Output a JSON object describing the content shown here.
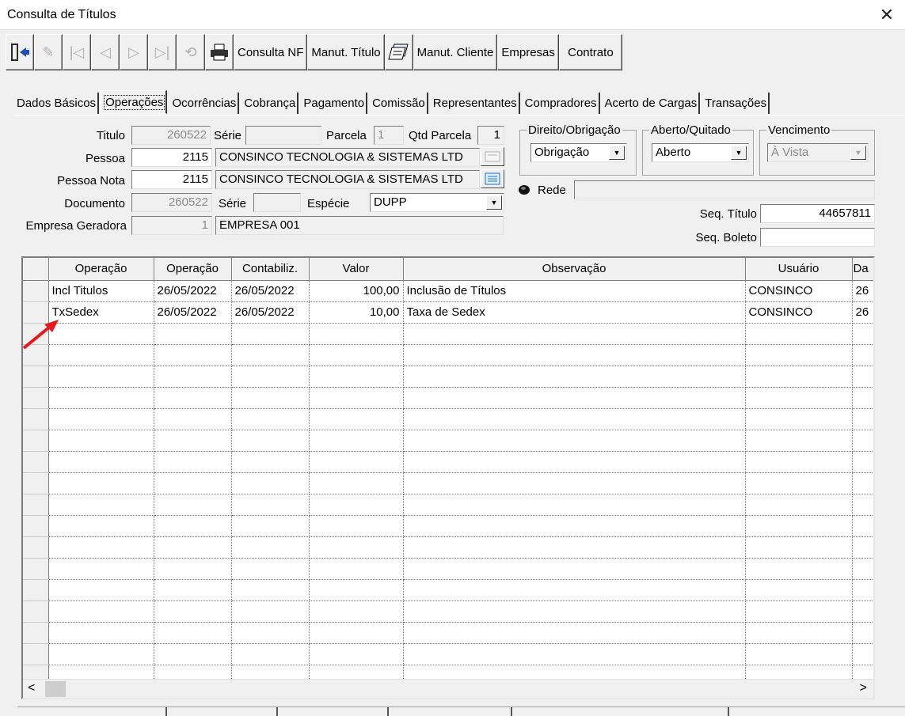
{
  "window": {
    "title": "Consulta de Títulos",
    "close_glyph": "✕"
  },
  "toolbar": {
    "buttons": [
      {
        "label": "Consulta NF"
      },
      {
        "label": "Manut. Título"
      },
      {
        "label": "Manut. Cliente"
      },
      {
        "label": "Empresas"
      },
      {
        "label": "Contrato"
      }
    ]
  },
  "tabs": [
    "Dados Básicos",
    "Operações",
    "Ocorrências",
    "Cobrança",
    "Pagamento",
    "Comissão",
    "Representantes",
    "Compradores",
    "Acerto de Cargas",
    "Transações"
  ],
  "active_tab": "Operações",
  "form": {
    "titulo_label": "Titulo",
    "titulo_value": "260522",
    "serie_label": "Série",
    "serie_value": "",
    "parcela_label": "Parcela",
    "parcela_value": "1",
    "qtd_parcela_label": "Qtd Parcela",
    "qtd_parcela_value": "1",
    "pessoa_label": "Pessoa",
    "pessoa_code": "2115",
    "pessoa_name": "CONSINCO TECNOLOGIA & SISTEMAS LTD",
    "pessoa_nota_label": "Pessoa Nota",
    "pessoa_nota_code": "2115",
    "pessoa_nota_name": "CONSINCO TECNOLOGIA & SISTEMAS LTD",
    "documento_label": "Documento",
    "documento_value": "260522",
    "serie2_label": "Série",
    "serie2_value": "",
    "especie_label": "Espécie",
    "especie_value": "DUPP",
    "empresa_label": "Empresa Geradora",
    "empresa_code": "1",
    "empresa_name": "EMPRESA 001",
    "direito_label": "Direito/Obrigação",
    "direito_value": "Obrigação",
    "aberto_label": "Aberto/Quitado",
    "aberto_value": "Aberto",
    "vencimento_label": "Vencimento",
    "vencimento_value": "À Vista",
    "rede_label": "Rede",
    "rede_value": "",
    "seq_titulo_label": "Seq. Título",
    "seq_titulo_value": "44657811",
    "seq_boleto_label": "Seq. Boleto",
    "seq_boleto_value": ""
  },
  "grid": {
    "headers": [
      "Operação",
      "Operação",
      "Contabiliz.",
      "Valor",
      "Observação",
      "Usuário",
      "Da"
    ],
    "rows": [
      [
        "Incl Titulos",
        "26/05/2022",
        "26/05/2022",
        "100,00",
        "Inclusão de Títulos",
        "CONSINCO",
        "26"
      ],
      [
        "TxSedex",
        "26/05/2022",
        "26/05/2022",
        "10,00",
        "Taxa de Sedex",
        "CONSINCO",
        "26"
      ]
    ],
    "empty_rows": 17
  },
  "scroll": {
    "left": "<",
    "right": ">"
  },
  "colors": {
    "annotation_arrow": "#e8191c",
    "window_bg": "#f0f0f0"
  }
}
